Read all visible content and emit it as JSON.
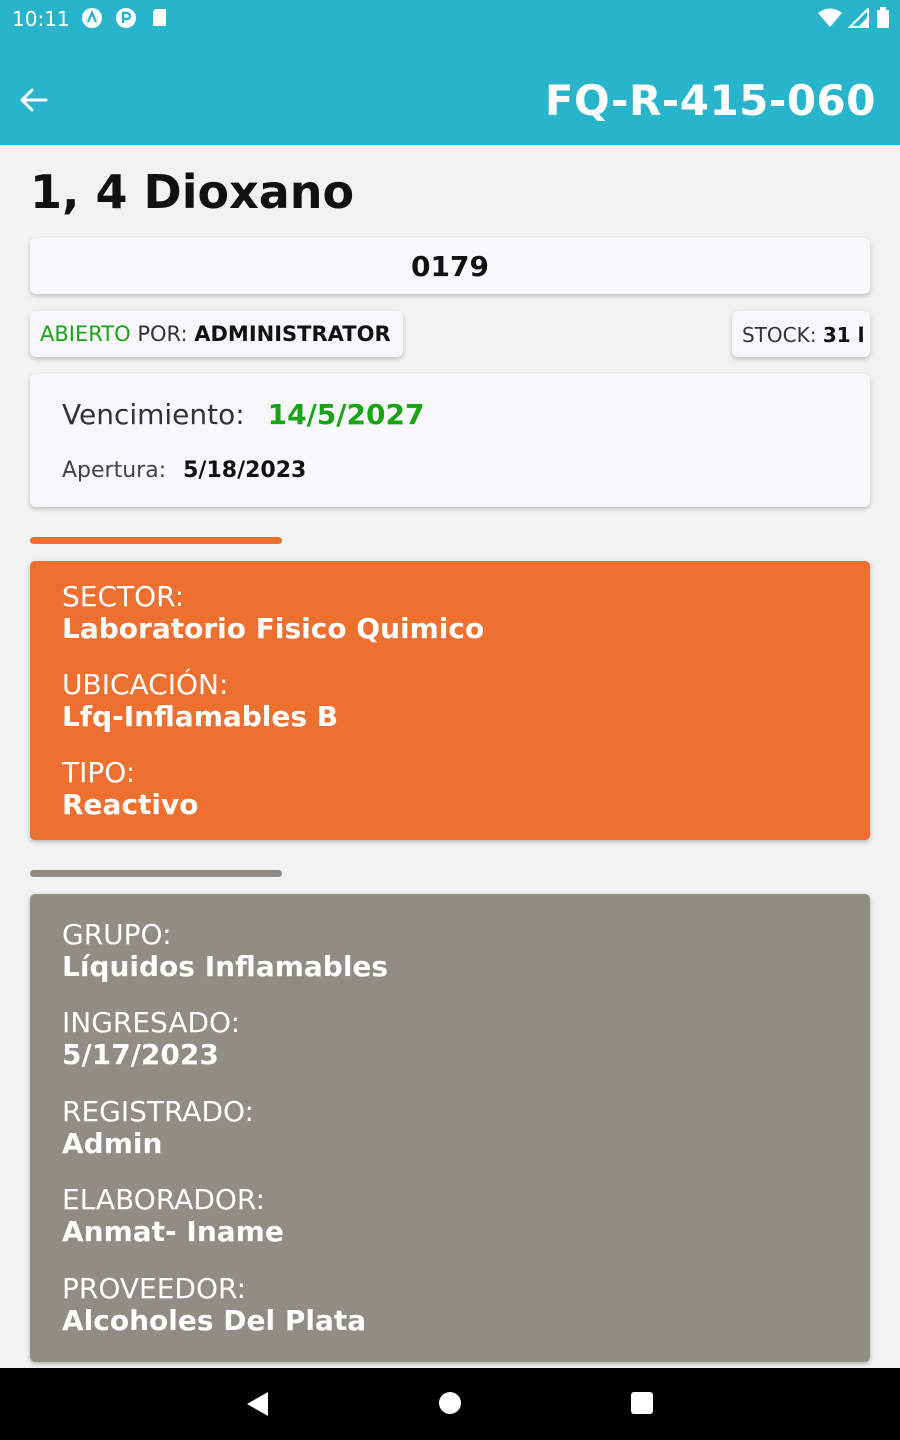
{
  "status_bar": {
    "time": "10:11",
    "left_icons": [
      "a-app-icon",
      "p-app-icon",
      "sd-card-icon"
    ],
    "right_icons": [
      "wifi-icon",
      "signal-icon",
      "battery-icon"
    ]
  },
  "app_bar": {
    "title": "FQ-R-415-060",
    "back_icon": "arrow-left-icon",
    "color": "#28b5cc"
  },
  "product": {
    "name": "1, 4 Dioxano",
    "code": "0179"
  },
  "open_chip": {
    "status": "ABIERTO",
    "por_label": "POR:",
    "user": "ADMINISTRATOR"
  },
  "stock_chip": {
    "label": "STOCK:",
    "value": "31 l"
  },
  "dates": {
    "vencimiento_label": "Vencimiento:",
    "vencimiento_value": "14/5/2027",
    "apertura_label": "Apertura:",
    "apertura_value": "5/18/2023"
  },
  "orange_section": {
    "color": "#ee7030",
    "fields": [
      {
        "label": "SECTOR:",
        "value": "Laboratorio Fisico Quimico"
      },
      {
        "label": "UBICACIÓN:",
        "value": "Lfq-Inflamables B"
      },
      {
        "label": "TIPO:",
        "value": "Reactivo"
      }
    ]
  },
  "gray_section": {
    "color": "#908c86",
    "fields": [
      {
        "label": "GRUPO:",
        "value": "Líquidos Inflamables"
      },
      {
        "label": "INGRESADO:",
        "value": "5/17/2023"
      },
      {
        "label": "REGISTRADO:",
        "value": "Admin"
      },
      {
        "label": "ELABORADOR:",
        "value": "Anmat- Iname"
      },
      {
        "label": "PROVEEDOR:",
        "value": "Alcoholes Del Plata"
      }
    ]
  },
  "nav_bar": {
    "buttons": [
      "back-triangle-icon",
      "home-circle-icon",
      "recents-square-icon"
    ]
  }
}
